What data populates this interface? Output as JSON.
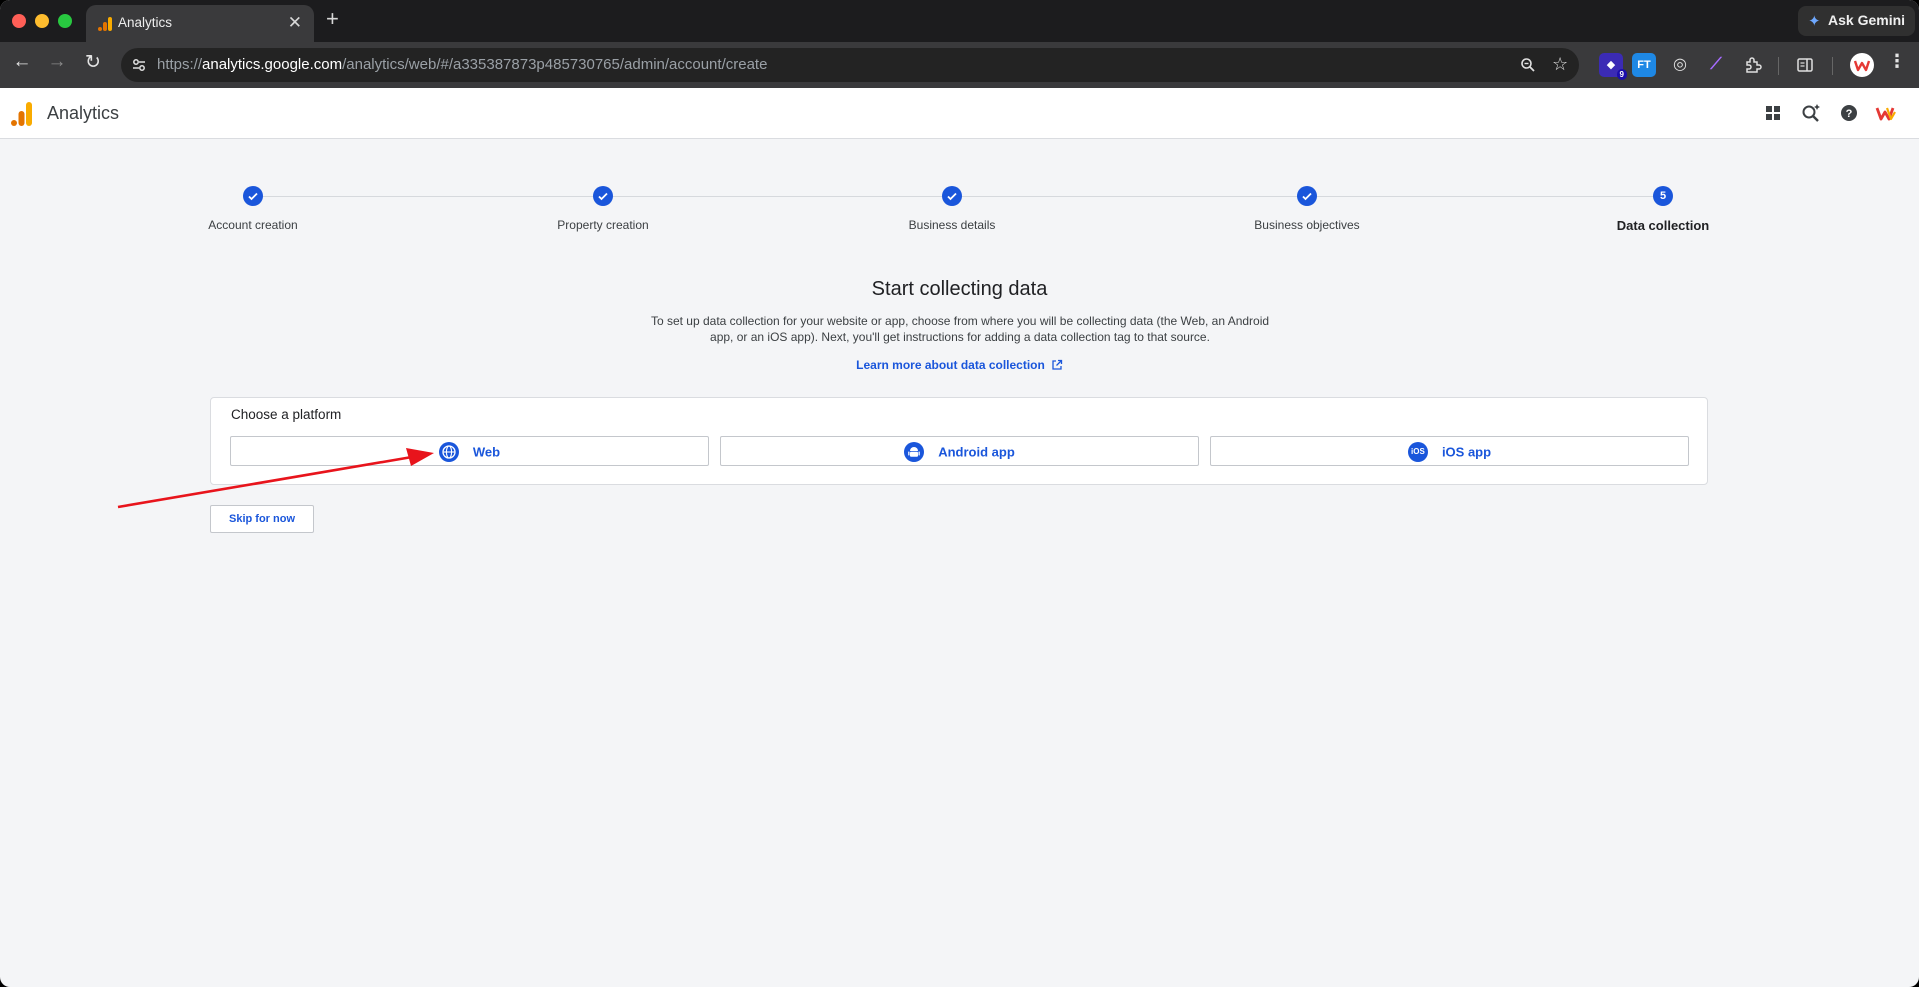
{
  "browser": {
    "tab_title": "Analytics",
    "new_tab_glyph": "+",
    "close_glyph": "✕",
    "ask_gemini": "Ask Gemini",
    "url_scheme": "https://",
    "url_host": "analytics.google.com",
    "url_path": "/analytics/web/#/a335387873p485730765/admin/account/create",
    "extension_badge": "9",
    "extension_ft_label": "FT",
    "icons": [
      "back-icon",
      "forward-icon",
      "reload-icon",
      "site-info-icon",
      "zoom-icon",
      "bookmark-star-icon",
      "extensions-icon",
      "side-panel-icon",
      "menu-icon"
    ]
  },
  "app": {
    "name": "Analytics",
    "icons": [
      "apps-grid-icon",
      "search-insights-icon",
      "help-icon",
      "account-avatar-icon"
    ]
  },
  "stepper": {
    "steps": [
      {
        "label": "Account creation",
        "state": "done"
      },
      {
        "label": "Property creation",
        "state": "done"
      },
      {
        "label": "Business details",
        "state": "done"
      },
      {
        "label": "Business objectives",
        "state": "done"
      },
      {
        "label": "Data collection",
        "state": "current",
        "number": "5"
      }
    ]
  },
  "main": {
    "headline": "Start collecting data",
    "description_line1": "To set up data collection for your website or app, choose from where you will be collecting data (the Web, an Android",
    "description_line2": "app, or an iOS app). Next, you'll get instructions for adding a data collection tag to that source.",
    "learn_more": "Learn more about data collection",
    "card_title": "Choose a platform",
    "platforms": [
      {
        "label": "Web",
        "icon": "globe-icon"
      },
      {
        "label": "Android app",
        "icon": "android-icon"
      },
      {
        "label": "iOS app",
        "icon": "ios-icon",
        "icon_text": "iOS"
      }
    ],
    "skip_label": "Skip for now"
  },
  "colors": {
    "accent": "#1a56db",
    "annotation_arrow": "#e8141c",
    "ga_orange": "#f9ab00",
    "ga_dark_orange": "#e37400"
  }
}
